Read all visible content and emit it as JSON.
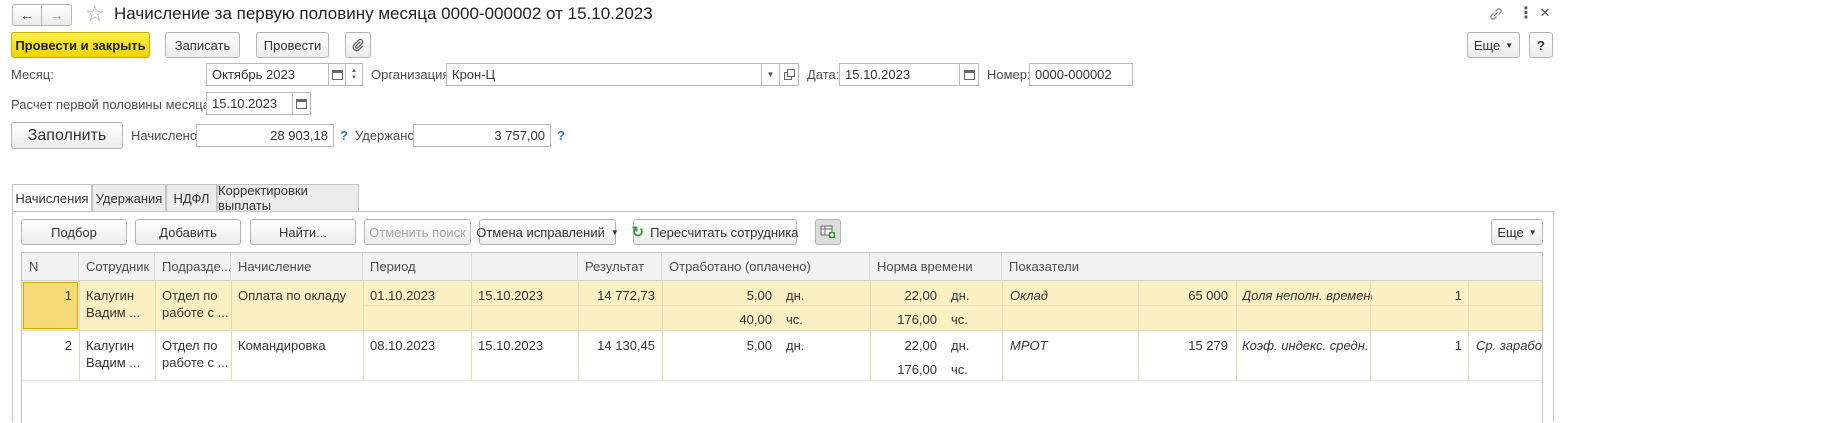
{
  "window": {
    "title": "Начисление за первую половину месяца 0000-000002 от 15.10.2023"
  },
  "toolbar": {
    "post_close": "Провести и закрыть",
    "save": "Записать",
    "post": "Провести",
    "more": "Еще",
    "help": "?"
  },
  "header": {
    "month_label": "Месяц:",
    "month_value": "Октябрь 2023",
    "org_label": "Организация:",
    "org_value": "Крон-Ц",
    "date_label": "Дата:",
    "date_value": "15.10.2023",
    "number_label": "Номер:",
    "number_value": "0000-000002",
    "calc_label": "Расчет первой половины месяца до:",
    "calc_value": "15.10.2023",
    "fill_button": "Заполнить",
    "accrued_label": "Начислено:",
    "accrued_value": "28 903,18",
    "withheld_label": "Удержано:",
    "withheld_value": "3 757,00",
    "q": "?"
  },
  "tabs": [
    {
      "label": "Начисления",
      "active": true
    },
    {
      "label": "Удержания"
    },
    {
      "label": "НДФЛ"
    },
    {
      "label": "Корректировки выплаты"
    }
  ],
  "table_toolbar": {
    "pick": "Подбор",
    "add": "Добавить",
    "find": "Найти...",
    "cancel_search": "Отменить поиск",
    "cancel_corrections": "Отмена исправлений",
    "recalc": "Пересчитать сотрудника",
    "more": "Еще"
  },
  "table": {
    "columns": [
      "N",
      "Сотрудник",
      "Подразде...",
      "Начисление",
      "Период",
      "Результат",
      "Отработано (оплачено)",
      "Норма времени",
      "Показатели"
    ],
    "rows": [
      {
        "n": "1",
        "employee": [
          "Калугин",
          "Вадим ..."
        ],
        "dept": [
          "Отдел по",
          "работе с ..."
        ],
        "accrual": "Оплата по окладу",
        "period_from": "01.10.2023",
        "period_to": "15.10.2023",
        "result": "14 772,73",
        "worked_days": "5,00",
        "worked_days_unit": "дн.",
        "worked_hours": "40,00",
        "worked_hours_unit": "чс.",
        "norm_days": "22,00",
        "norm_days_unit": "дн.",
        "norm_hours": "176,00",
        "norm_hours_unit": "чс.",
        "ind1_name": "Оклад",
        "ind1_value": "65 000",
        "ind2_name": "Доля неполн. времени",
        "ind2_value": "1",
        "ind3_name": ""
      },
      {
        "n": "2",
        "employee": [
          "Калугин",
          "Вадим ..."
        ],
        "dept": [
          "Отдел по",
          "работе с ..."
        ],
        "accrual": "Командировка",
        "period_from": "08.10.2023",
        "period_to": "15.10.2023",
        "result": "14 130,45",
        "worked_days": "5,00",
        "worked_days_unit": "дн.",
        "worked_hours": "",
        "worked_hours_unit": "",
        "norm_days": "22,00",
        "norm_days_unit": "дн.",
        "norm_hours": "176,00",
        "norm_hours_unit": "чс.",
        "ind1_name": "МРОТ",
        "ind1_value": "15 279",
        "ind2_name": "Коэф. индекс. средн.",
        "ind2_value": "1",
        "ind3_name": "Ср. заработо"
      }
    ]
  },
  "colors": {
    "primary_button": "#f2d400",
    "selected_row": "#fbf0c4",
    "active_cell": "#f7d977",
    "link_blue": "#2d78c2",
    "recalc_green": "#3a9a3a"
  }
}
